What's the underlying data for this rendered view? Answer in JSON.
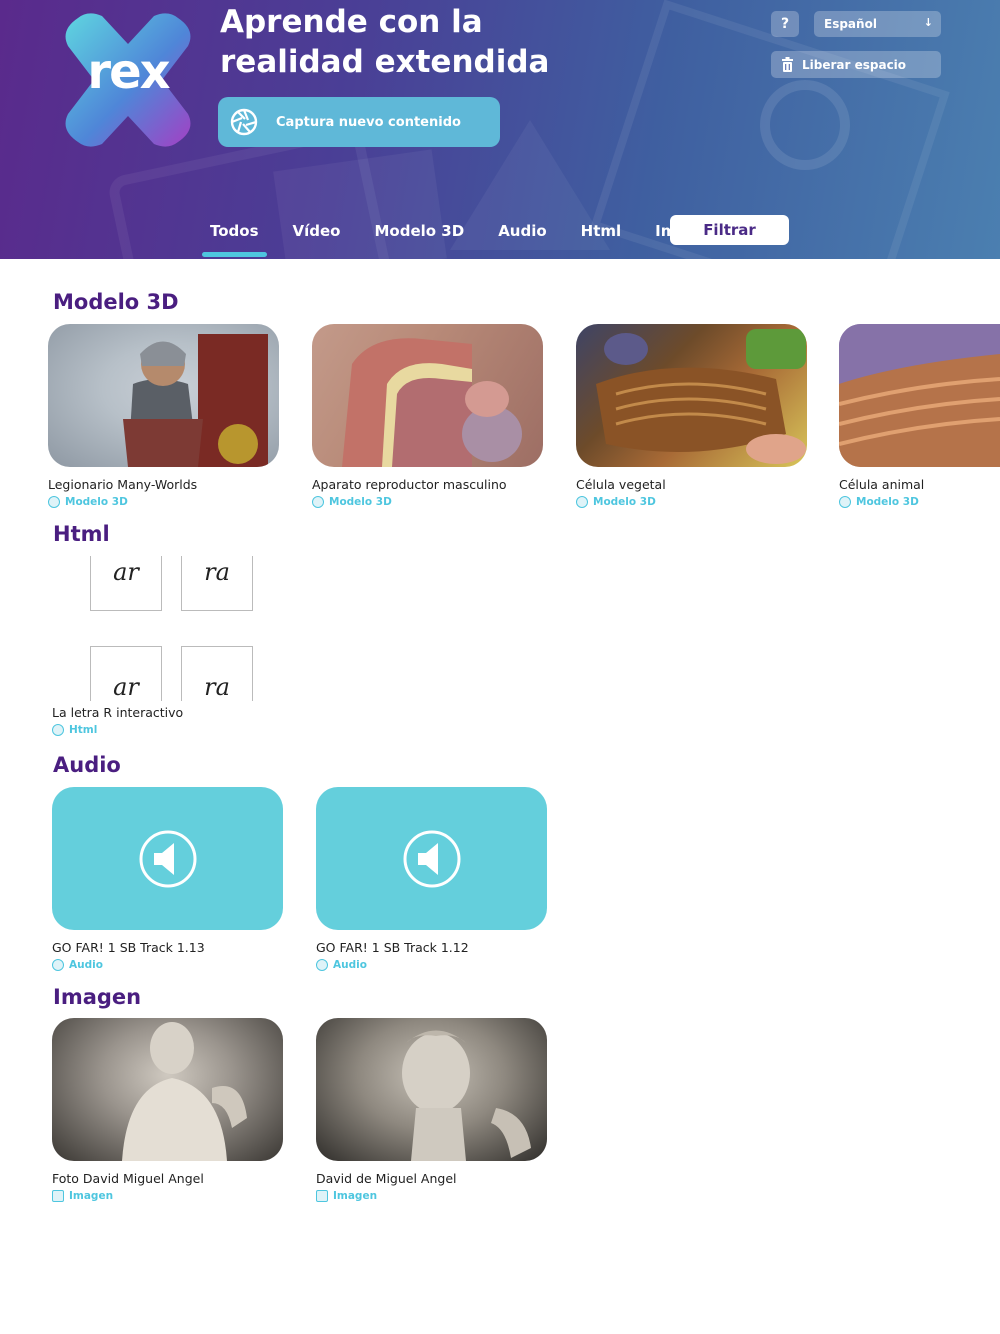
{
  "header": {
    "logo_text": "rex",
    "headline_line1": "Aprende con la",
    "headline_line2": "realidad extendida",
    "capture_label": "Captura nuevo contenido",
    "help_label": "?",
    "language": "Español",
    "free_space_label": "Liberar espacio",
    "tabs": [
      "Todos",
      "Vídeo",
      "Modelo 3D",
      "Audio",
      "Html",
      "Imagen"
    ],
    "active_tab": "Todos",
    "filter_label": "Filtrar"
  },
  "sections": {
    "modelo3d": {
      "title": "Modelo 3D",
      "items": [
        {
          "title": "Legionario Many-Worlds",
          "type": "Modelo 3D"
        },
        {
          "title": "Aparato reproductor masculino",
          "type": "Modelo 3D"
        },
        {
          "title": "Célula vegetal",
          "type": "Modelo 3D"
        },
        {
          "title": "Célula animal",
          "type": "Modelo 3D"
        }
      ]
    },
    "html": {
      "title": "Html",
      "letters": [
        "ar",
        "ra",
        "ar",
        "ra"
      ],
      "items": [
        {
          "title": "La letra R interactivo",
          "type": "Html"
        }
      ]
    },
    "audio": {
      "title": "Audio",
      "items": [
        {
          "title": "GO FAR! 1 SB Track 1.13",
          "type": "Audio"
        },
        {
          "title": "GO FAR! 1 SB Track 1.12",
          "type": "Audio"
        }
      ]
    },
    "imagen": {
      "title": "Imagen",
      "items": [
        {
          "title": "Foto David Miguel Angel",
          "type": "Imagen"
        },
        {
          "title": "David de Miguel Angel",
          "type": "Imagen"
        }
      ]
    }
  },
  "colors": {
    "accent": "#4ec6df",
    "brand_purple": "#4a1e80",
    "audio_tile": "#64cfdc",
    "capture_button": "#5fb8d8"
  }
}
